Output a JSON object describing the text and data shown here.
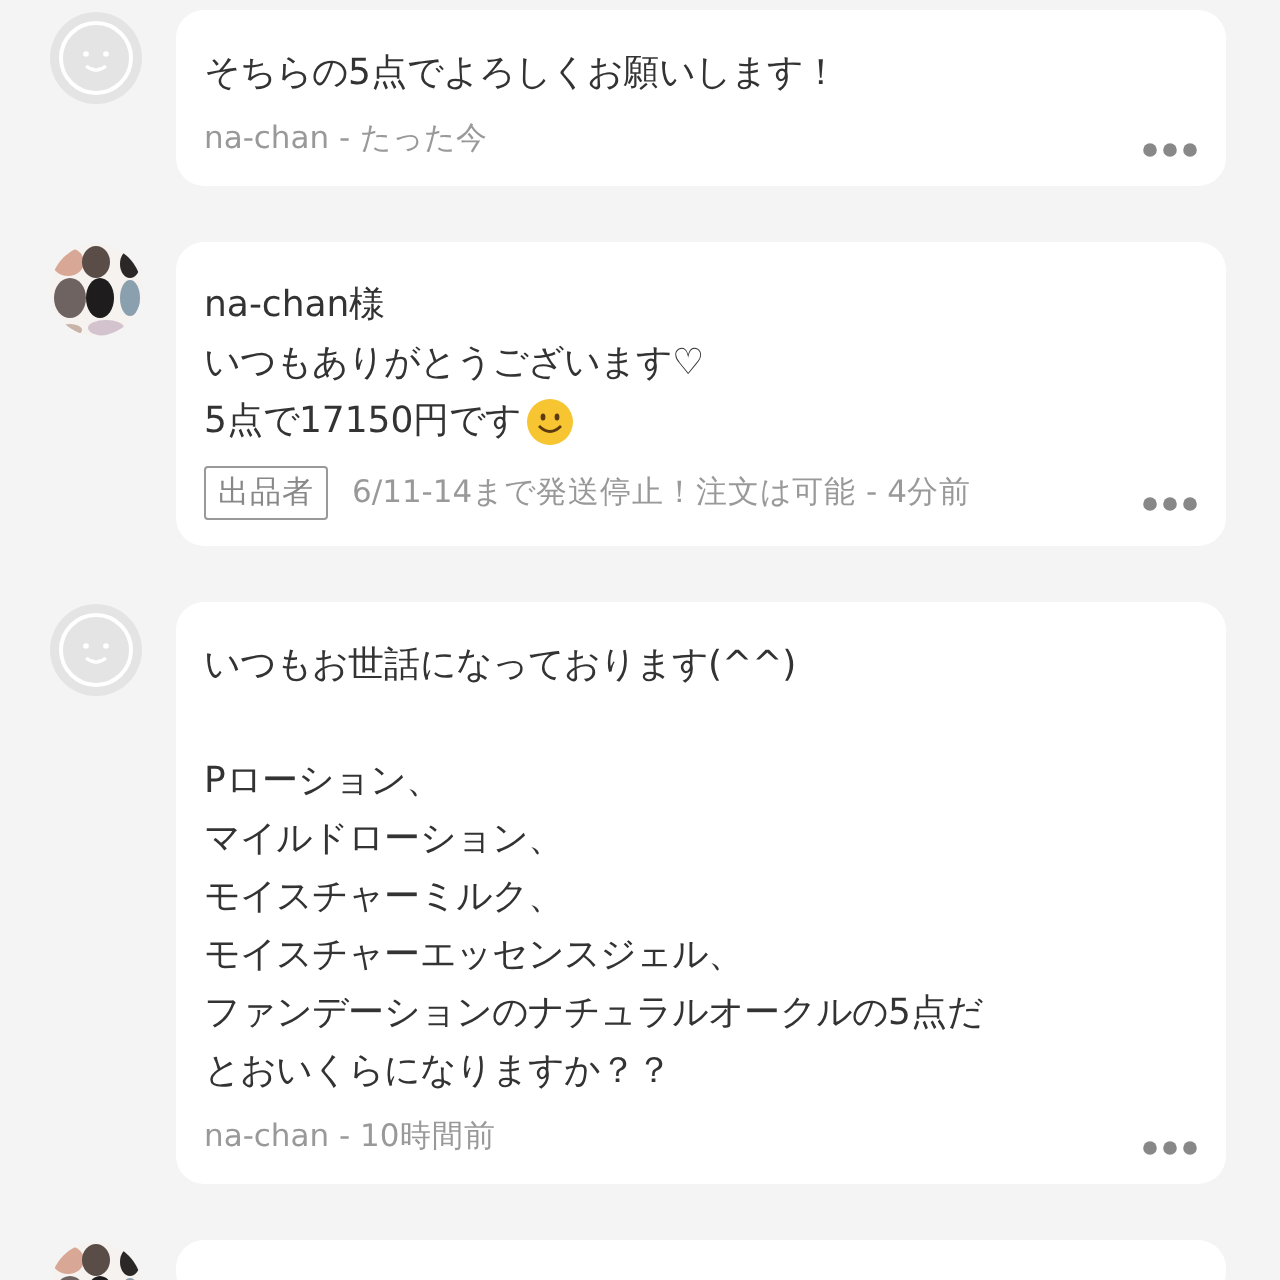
{
  "comments": [
    {
      "kind": "default",
      "paragraphs": [
        [
          "そちらの5点でよろしくお願いします！"
        ]
      ],
      "meta": "na-chan - たった今",
      "emoji": false
    },
    {
      "kind": "picture",
      "paragraphs": [
        [
          "na-chan様",
          "いつもありがとうございます♡",
          "5点で17150円です"
        ]
      ],
      "emoji": true,
      "badge": "出品者",
      "meta": "6/11-14まで発送停止！注文は可能 - 4分前"
    },
    {
      "kind": "default",
      "paragraphs": [
        [
          "いつもお世話になっております(^^)"
        ],
        [
          "Pローション、",
          "マイルドローション、",
          "モイスチャーミルク、",
          "モイスチャーエッセンスジェル、",
          "ファンデーションのナチュラルオークルの5点だ",
          "とおいくらになりますか？？"
        ]
      ],
      "meta": "na-chan - 10時間前",
      "emoji": false
    },
    {
      "kind": "picture"
    }
  ]
}
